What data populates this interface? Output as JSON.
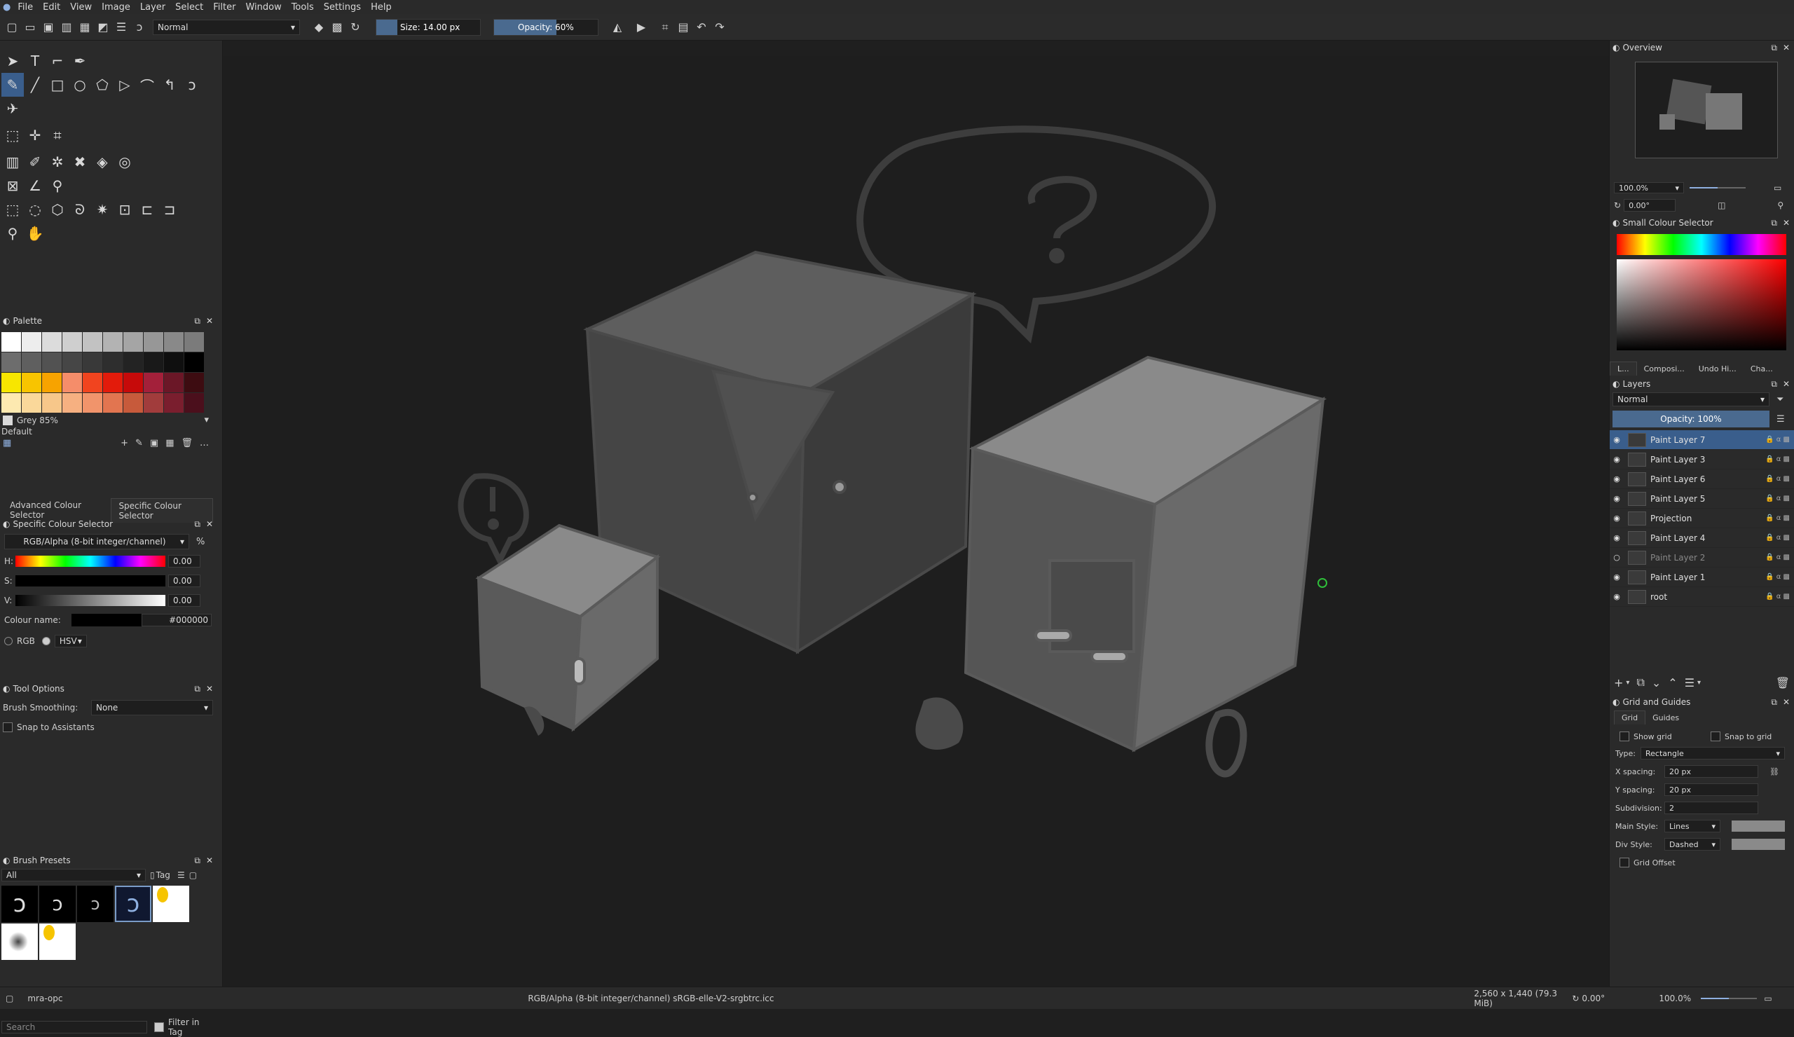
{
  "menu": [
    "File",
    "Edit",
    "View",
    "Image",
    "Layer",
    "Select",
    "Filter",
    "Window",
    "Tools",
    "Settings",
    "Help"
  ],
  "toolbar": {
    "blend_mode": "Normal",
    "size": "Size: 14.00 px",
    "opacity": "Opacity: 60%",
    "accent": "#4a6a8f"
  },
  "palette": {
    "title": "Palette",
    "colors": [
      [
        "#ffffff",
        "#ededed",
        "#dcdcdc",
        "#cfcfcf",
        "#c2c2c2",
        "#b3b3b3",
        "#a5a5a5",
        "#979797",
        "#898989",
        "#7b7b7b"
      ],
      [
        "#6d6d6d",
        "#5f5f5f",
        "#525252",
        "#464646",
        "#393939",
        "#2e2e2e",
        "#232323",
        "#191919",
        "#0f0f0f",
        "#000000"
      ],
      [
        "#f7e600",
        "#f8c400",
        "#f7a300",
        "#f58d6a",
        "#f1441f",
        "#e31b0b",
        "#c60a0a",
        "#a3203a",
        "#6b1727",
        "#3d0c11"
      ],
      [
        "#fde9b0",
        "#fad89a",
        "#f7c78a",
        "#f6b081",
        "#f1946b",
        "#e27550",
        "#c75a3b",
        "#a13c3c",
        "#7a1e2e",
        "#4b0f1c"
      ]
    ],
    "selected_name": "Grey 85%",
    "set_name": "Default"
  },
  "colour_selector_tabs": [
    "Advanced Colour Selector",
    "Specific Colour Selector"
  ],
  "specific_colour": {
    "title": "Specific Colour Selector",
    "model": "RGB/Alpha (8-bit integer/channel)",
    "h_label": "H:",
    "h_value": "0.00",
    "s_label": "S:",
    "s_value": "0.00",
    "v_label": "V:",
    "v_value": "0.00",
    "name_label": "Colour name:",
    "name_value": "#000000",
    "rgb_label": "RGB",
    "hsv_label": "HSV"
  },
  "tool_options": {
    "title": "Tool Options",
    "smoothing_label": "Brush Smoothing:",
    "smoothing_value": "None",
    "snap_label": "Snap to Assistants"
  },
  "brush_presets": {
    "title": "Brush Presets",
    "filter": "All",
    "tag": "Tag",
    "search_placeholder": "Search",
    "filter_in_tag": "Filter in Tag"
  },
  "overview": {
    "title": "Overview",
    "zoom": "100.0%",
    "rotation": "0.00°"
  },
  "small_colour": {
    "title": "Small Colour Selector"
  },
  "dock_tabs": [
    "L...",
    "Composi...",
    "Undo Hi...",
    "Cha..."
  ],
  "layers": {
    "title": "Layers",
    "blend": "Normal",
    "opacity": "Opacity:  100%",
    "items": [
      {
        "name": "Paint Layer 7",
        "visible": true,
        "active": true
      },
      {
        "name": "Paint Layer 3",
        "visible": true,
        "active": false
      },
      {
        "name": "Paint Layer 6",
        "visible": true,
        "active": false
      },
      {
        "name": "Paint Layer 5",
        "visible": true,
        "active": false
      },
      {
        "name": "Projection",
        "visible": true,
        "active": false
      },
      {
        "name": "Paint Layer 4",
        "visible": true,
        "active": false
      },
      {
        "name": "Paint Layer 2",
        "visible": false,
        "active": false
      },
      {
        "name": "Paint Layer 1",
        "visible": true,
        "active": false
      },
      {
        "name": "root",
        "visible": true,
        "active": false
      }
    ]
  },
  "grid": {
    "title": "Grid and Guides",
    "tabs": [
      "Grid",
      "Guides"
    ],
    "show_grid": "Show grid",
    "snap_grid": "Snap to grid",
    "type_label": "Type:",
    "type_value": "Rectangle",
    "xspacing_label": "X spacing:",
    "xspacing_value": "20 px",
    "yspacing_label": "Y spacing:",
    "yspacing_value": "20 px",
    "subdivision_label": "Subdivision:",
    "subdivision_value": "2",
    "main_style_label": "Main Style:",
    "main_style_value": "Lines",
    "div_style_label": "Div Style:",
    "div_style_value": "Dashed",
    "offset_label": "Grid Offset"
  },
  "status": {
    "file": "mra-opc",
    "colorspace": "RGB/Alpha (8-bit integer/channel)  sRGB-elle-V2-srgbtrc.icc",
    "size": "2,560 x 1,440 (79.3 MiB)",
    "rotation": "0.00°",
    "zoom": "100.0%"
  }
}
